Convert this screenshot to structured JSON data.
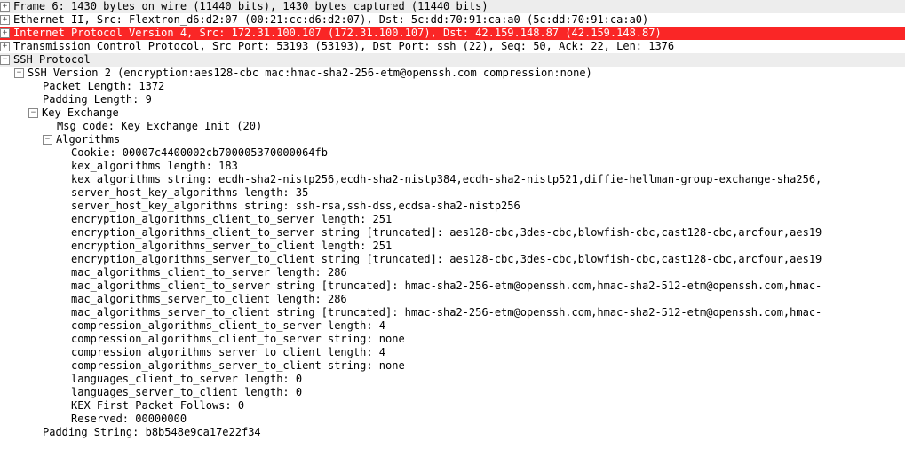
{
  "rows": [
    {
      "indent": 0,
      "twist": "+",
      "alt": true,
      "sel": false,
      "text": "Frame 6: 1430 bytes on wire (11440 bits), 1430 bytes captured (11440 bits)"
    },
    {
      "indent": 0,
      "twist": "+",
      "alt": false,
      "sel": false,
      "text": "Ethernet II, Src: Flextron_d6:d2:07 (00:21:cc:d6:d2:07), Dst: 5c:dd:70:91:ca:a0 (5c:dd:70:91:ca:a0)"
    },
    {
      "indent": 0,
      "twist": "+",
      "alt": false,
      "sel": true,
      "text": "Internet Protocol Version 4, Src: 172.31.100.107 (172.31.100.107), Dst: 42.159.148.87 (42.159.148.87)"
    },
    {
      "indent": 0,
      "twist": "+",
      "alt": false,
      "sel": false,
      "text": "Transmission Control Protocol, Src Port: 53193 (53193), Dst Port: ssh (22), Seq: 50, Ack: 22, Len: 1376"
    },
    {
      "indent": 0,
      "twist": "-",
      "alt": true,
      "sel": false,
      "text": "SSH Protocol"
    },
    {
      "indent": 1,
      "twist": "-",
      "alt": false,
      "sel": false,
      "text": "SSH Version 2 (encryption:aes128-cbc mac:hmac-sha2-256-etm@openssh.com compression:none)"
    },
    {
      "indent": 2,
      "twist": "",
      "alt": false,
      "sel": false,
      "text": "Packet Length: 1372"
    },
    {
      "indent": 2,
      "twist": "",
      "alt": false,
      "sel": false,
      "text": "Padding Length: 9"
    },
    {
      "indent": 2,
      "twist": "-",
      "alt": false,
      "sel": false,
      "text": "Key Exchange"
    },
    {
      "indent": 3,
      "twist": "",
      "alt": false,
      "sel": false,
      "text": "Msg code: Key Exchange Init (20)"
    },
    {
      "indent": 3,
      "twist": "-",
      "alt": false,
      "sel": false,
      "text": "Algorithms"
    },
    {
      "indent": 4,
      "twist": "",
      "alt": false,
      "sel": false,
      "text": "Cookie: 00007c4400002cb700005370000064fb"
    },
    {
      "indent": 4,
      "twist": "",
      "alt": false,
      "sel": false,
      "text": "kex_algorithms length: 183"
    },
    {
      "indent": 4,
      "twist": "",
      "alt": false,
      "sel": false,
      "text": "kex_algorithms string: ecdh-sha2-nistp256,ecdh-sha2-nistp384,ecdh-sha2-nistp521,diffie-hellman-group-exchange-sha256,"
    },
    {
      "indent": 4,
      "twist": "",
      "alt": false,
      "sel": false,
      "text": "server_host_key_algorithms length: 35"
    },
    {
      "indent": 4,
      "twist": "",
      "alt": false,
      "sel": false,
      "text": "server_host_key_algorithms string: ssh-rsa,ssh-dss,ecdsa-sha2-nistp256"
    },
    {
      "indent": 4,
      "twist": "",
      "alt": false,
      "sel": false,
      "text": "encryption_algorithms_client_to_server length: 251"
    },
    {
      "indent": 4,
      "twist": "",
      "alt": false,
      "sel": false,
      "text": "encryption_algorithms_client_to_server string [truncated]: aes128-cbc,3des-cbc,blowfish-cbc,cast128-cbc,arcfour,aes19"
    },
    {
      "indent": 4,
      "twist": "",
      "alt": false,
      "sel": false,
      "text": "encryption_algorithms_server_to_client length: 251"
    },
    {
      "indent": 4,
      "twist": "",
      "alt": false,
      "sel": false,
      "text": "encryption_algorithms_server_to_client string [truncated]: aes128-cbc,3des-cbc,blowfish-cbc,cast128-cbc,arcfour,aes19"
    },
    {
      "indent": 4,
      "twist": "",
      "alt": false,
      "sel": false,
      "text": "mac_algorithms_client_to_server length: 286"
    },
    {
      "indent": 4,
      "twist": "",
      "alt": false,
      "sel": false,
      "text": "mac_algorithms_client_to_server string [truncated]: hmac-sha2-256-etm@openssh.com,hmac-sha2-512-etm@openssh.com,hmac-"
    },
    {
      "indent": 4,
      "twist": "",
      "alt": false,
      "sel": false,
      "text": "mac_algorithms_server_to_client length: 286"
    },
    {
      "indent": 4,
      "twist": "",
      "alt": false,
      "sel": false,
      "text": "mac_algorithms_server_to_client string [truncated]: hmac-sha2-256-etm@openssh.com,hmac-sha2-512-etm@openssh.com,hmac-"
    },
    {
      "indent": 4,
      "twist": "",
      "alt": false,
      "sel": false,
      "text": "compression_algorithms_client_to_server length: 4"
    },
    {
      "indent": 4,
      "twist": "",
      "alt": false,
      "sel": false,
      "text": "compression_algorithms_client_to_server string: none"
    },
    {
      "indent": 4,
      "twist": "",
      "alt": false,
      "sel": false,
      "text": "compression_algorithms_server_to_client length: 4"
    },
    {
      "indent": 4,
      "twist": "",
      "alt": false,
      "sel": false,
      "text": "compression_algorithms_server_to_client string: none"
    },
    {
      "indent": 4,
      "twist": "",
      "alt": false,
      "sel": false,
      "text": "languages_client_to_server length: 0"
    },
    {
      "indent": 4,
      "twist": "",
      "alt": false,
      "sel": false,
      "text": "languages_server_to_client length: 0"
    },
    {
      "indent": 4,
      "twist": "",
      "alt": false,
      "sel": false,
      "text": "KEX First Packet Follows: 0"
    },
    {
      "indent": 4,
      "twist": "",
      "alt": false,
      "sel": false,
      "text": "Reserved: 00000000"
    },
    {
      "indent": 2,
      "twist": "",
      "alt": false,
      "sel": false,
      "text": "Padding String: b8b548e9ca17e22f34"
    }
  ],
  "expand_glyph": "+",
  "collapse_glyph": "−"
}
